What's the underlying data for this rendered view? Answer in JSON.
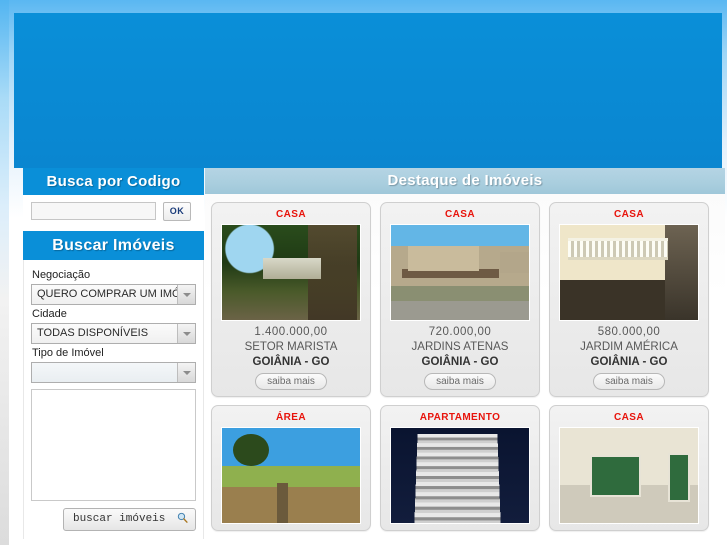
{
  "site": {
    "banner_alt": "banner"
  },
  "sidebar": {
    "codigo_panel": {
      "title": "Busca por Codigo",
      "input_value": "",
      "input_placeholder": "",
      "ok_label": "OK"
    },
    "buscar_panel": {
      "title": "Buscar Imóveis",
      "fields": [
        {
          "label": "Negociação",
          "value": "QUERO COMPRAR UM IMÓVEL"
        },
        {
          "label": "Cidade",
          "value": "TODAS DISPONÍVEIS"
        },
        {
          "label": "Tipo de Imóvel",
          "value": ""
        }
      ],
      "submit_label": "buscar imóveis",
      "submit_icon": "magnifier-icon"
    }
  },
  "main": {
    "heading": "Destaque de Imóveis",
    "more_label": "saiba mais",
    "cards": [
      {
        "type": "CASA",
        "price": "1.400.000,00",
        "neighborhood": "SETOR MARISTA",
        "city": "GOIÂNIA - GO",
        "photo": "ph-house1"
      },
      {
        "type": "CASA",
        "price": "720.000,00",
        "neighborhood": "JARDINS ATENAS",
        "city": "GOIÂNIA - GO",
        "photo": "ph-house2"
      },
      {
        "type": "CASA",
        "price": "580.000,00",
        "neighborhood": "JARDIM AMÉRICA",
        "city": "GOIÂNIA - GO",
        "photo": "ph-house3"
      }
    ],
    "cards_row2": [
      {
        "type": "ÁREA",
        "photo": "ph-area"
      },
      {
        "type": "APARTAMENTO",
        "photo": "ph-apt"
      },
      {
        "type": "CASA",
        "photo": "ph-interior"
      }
    ]
  },
  "colors": {
    "brand_blue": "#0a8fd8",
    "heading_blue_grey": "#a9cede",
    "type_red": "#e8140c"
  }
}
